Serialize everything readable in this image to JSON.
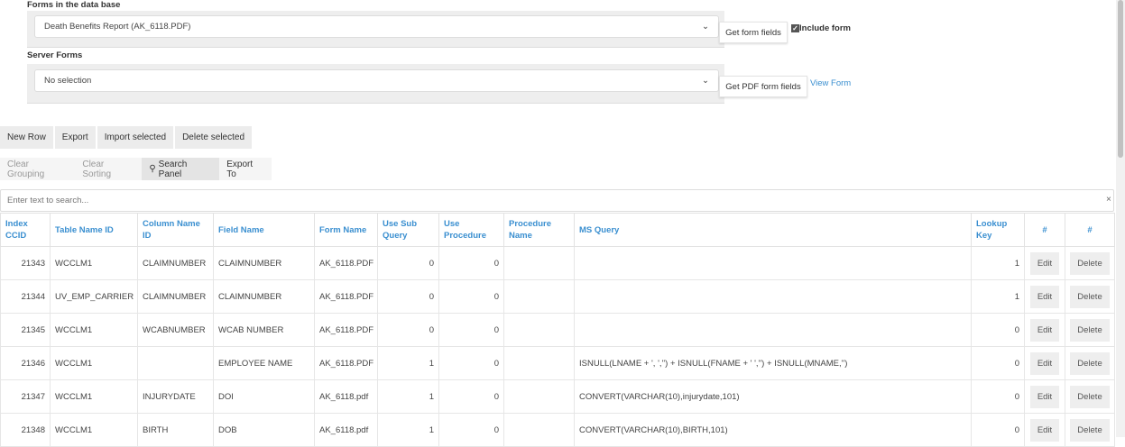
{
  "forms_db": {
    "label": "Forms in the data base",
    "selected": "Death Benefits Report (AK_6118.PDF)",
    "get_button": "Get form fields",
    "include_label": "Include form",
    "include_checked": true
  },
  "server_forms": {
    "label": "Server Forms",
    "selected": "No selection",
    "get_button": "Get PDF form fields",
    "view_link": "View Form"
  },
  "toolbar": [
    "New Row",
    "Export",
    "Import selected",
    "Delete selected"
  ],
  "grid_toolbar": {
    "clear_grouping": "Clear Grouping",
    "clear_sorting": "Clear Sorting",
    "search_panel": "Search Panel",
    "export_to": "Export To"
  },
  "search": {
    "placeholder": "Enter text to search...",
    "clear": "×"
  },
  "columns": [
    "Index CCID",
    "Table Name ID",
    "Column Name ID",
    "Field Name",
    "Form Name",
    "Use Sub Query",
    "Use Procedure",
    "Procedure Name",
    "MS Query",
    "Lookup Key",
    "#",
    "#"
  ],
  "rows": [
    [
      "21343",
      "WCCLM1",
      "CLAIMNUMBER",
      "CLAIMNUMBER",
      "AK_6118.PDF",
      "0",
      "0",
      "",
      "",
      "1",
      "Edit",
      "Delete"
    ],
    [
      "21344",
      "UV_EMP_CARRIER",
      "CLAIMNUMBER",
      "CLAIMNUMBER",
      "AK_6118.PDF",
      "0",
      "0",
      "",
      "",
      "1",
      "Edit",
      "Delete"
    ],
    [
      "21345",
      "WCCLM1",
      "WCABNUMBER",
      "WCAB NUMBER",
      "AK_6118.PDF",
      "0",
      "0",
      "",
      "",
      "0",
      "Edit",
      "Delete"
    ],
    [
      "21346",
      "WCCLM1",
      "",
      "EMPLOYEE NAME",
      "AK_6118.PDF",
      "1",
      "0",
      "",
      "ISNULL(LNAME + ', ','') + ISNULL(FNAME + ' ','') + ISNULL(MNAME,'')",
      "0",
      "Edit",
      "Delete"
    ],
    [
      "21347",
      "WCCLM1",
      "INJURYDATE",
      "DOI",
      "AK_6118.pdf",
      "1",
      "0",
      "",
      "CONVERT(VARCHAR(10),injurydate,101)",
      "0",
      "Edit",
      "Delete"
    ],
    [
      "21348",
      "WCCLM1",
      "BIRTH",
      "DOB",
      "AK_6118.pdf",
      "1",
      "0",
      "",
      "CONVERT(VARCHAR(10),BIRTH,101)",
      "0",
      "Edit",
      "Delete"
    ]
  ]
}
